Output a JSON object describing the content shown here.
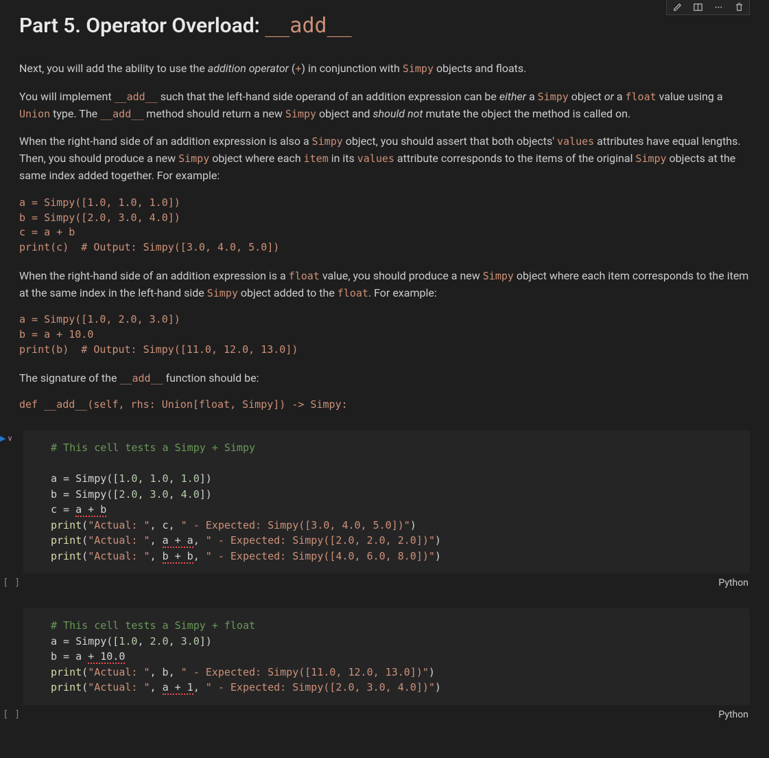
{
  "heading": {
    "prefix": "Part 5. Operator Overload: ",
    "code": "__add__"
  },
  "p1": {
    "t1": "Next, you will add the ability to use the ",
    "em1": "addition operator",
    "t2": " (",
    "c1": "+",
    "t3": ") in conjunction with ",
    "c2": "Simpy",
    "t4": " objects and floats."
  },
  "p2": {
    "t1": "You will implement ",
    "c1": "__add__",
    "t2": " such that the left-hand side operand of an addition expression can be ",
    "em1": "either",
    "t3": " a ",
    "c2": "Simpy",
    "t4": " object ",
    "em2": "or",
    "t5": " a ",
    "c3": "float",
    "t6": " value using a ",
    "c4": "Union",
    "t7": " type. The ",
    "c5": "__add__",
    "t8": " method should return a new ",
    "c6": "Simpy",
    "t9": " object and ",
    "em3": "should not",
    "t10": " mutate the object the method is called on."
  },
  "p3": {
    "t1": "When the right-hand side of an addition expression is also a ",
    "c1": "Simpy",
    "t2": " object, you should assert that both objects' ",
    "c2": "values",
    "t3": " attributes have equal lengths. Then, you should produce a new ",
    "c3": "Simpy",
    "t4": " object where each ",
    "c4": "item",
    "t5": " in its ",
    "c5": "values",
    "t6": " attribute corresponds to the items of the original ",
    "c6": "Simpy",
    "t7": " objects at the same index added together. For example:"
  },
  "code1": "a = Simpy([1.0, 1.0, 1.0])\nb = Simpy([2.0, 3.0, 4.0])\nc = a + b\nprint(c)  # Output: Simpy([3.0, 4.0, 5.0])",
  "p4": {
    "t1": "When the right-hand side of an addition expression is a ",
    "c1": "float",
    "t2": " value, you should produce a new ",
    "c2": "Simpy",
    "t3": " object where each item corresponds to the item at the same index in the left-hand side ",
    "c3": "Simpy",
    "t4": " object added to the ",
    "c4": "float",
    "t5": ". For example:"
  },
  "code2": "a = Simpy([1.0, 2.0, 3.0])\nb = a + 10.0\nprint(b)  # Output: Simpy([11.0, 12.0, 13.0])",
  "p5": {
    "t1": "The signature of the ",
    "c1": "__add__",
    "t2": " function should be:"
  },
  "code3": "def __add__(self, rhs: Union[float, Simpy]) -> Simpy:",
  "cells": {
    "c1": {
      "comment": "# This cell tests a Simpy + Simpy",
      "l2a": "a = Simpy([",
      "l2b": "1.0",
      "l2c": ", ",
      "l2d": "1.0",
      "l2e": ", ",
      "l2f": "1.0",
      "l2g": "])",
      "l3a": "b = Simpy([",
      "l3b": "2.0",
      "l3c": ", ",
      "l3d": "3.0",
      "l3e": ", ",
      "l3f": "4.0",
      "l3g": "])",
      "l4a": "c = ",
      "l4b": "a + b",
      "l5a": "print",
      "l5b": "(",
      "l5c": "\"Actual: \"",
      "l5d": ", c, ",
      "l5e": "\" - Expected: Simpy([3.0, 4.0, 5.0])\"",
      "l5f": ")",
      "l6a": "print",
      "l6b": "(",
      "l6c": "\"Actual: \"",
      "l6d": ", ",
      "l6e": "a + a",
      "l6f": ", ",
      "l6g": "\" - Expected: Simpy([2.0, 2.0, 2.0])\"",
      "l6h": ")",
      "l7a": "print",
      "l7b": "(",
      "l7c": "\"Actual: \"",
      "l7d": ", ",
      "l7e": "b + b",
      "l7f": ", ",
      "l7g": "\" - Expected: Simpy([4.0, 6.0, 8.0])\"",
      "l7h": ")"
    },
    "c2": {
      "comment": "# This cell tests a Simpy + float",
      "l2a": "a = Simpy([",
      "l2b": "1.0",
      "l2c": ", ",
      "l2d": "2.0",
      "l2e": ", ",
      "l2f": "3.0",
      "l2g": "])",
      "l3a": "b = a ",
      "l3b": "+ 10.0",
      "l4a": "print",
      "l4b": "(",
      "l4c": "\"Actual: \"",
      "l4d": ", b, ",
      "l4e": "\" - Expected: Simpy([11.0, 12.0, 13.0])\"",
      "l4f": ")",
      "l5a": "print",
      "l5b": "(",
      "l5c": "\"Actual: \"",
      "l5d": ", ",
      "l5e": "a + 1",
      "l5f": ", ",
      "l5g": "\" - Expected: Simpy([2.0, 3.0, 4.0])\"",
      "l5h": ")"
    }
  },
  "footer": {
    "exec": "[ ]",
    "lang": "Python"
  }
}
